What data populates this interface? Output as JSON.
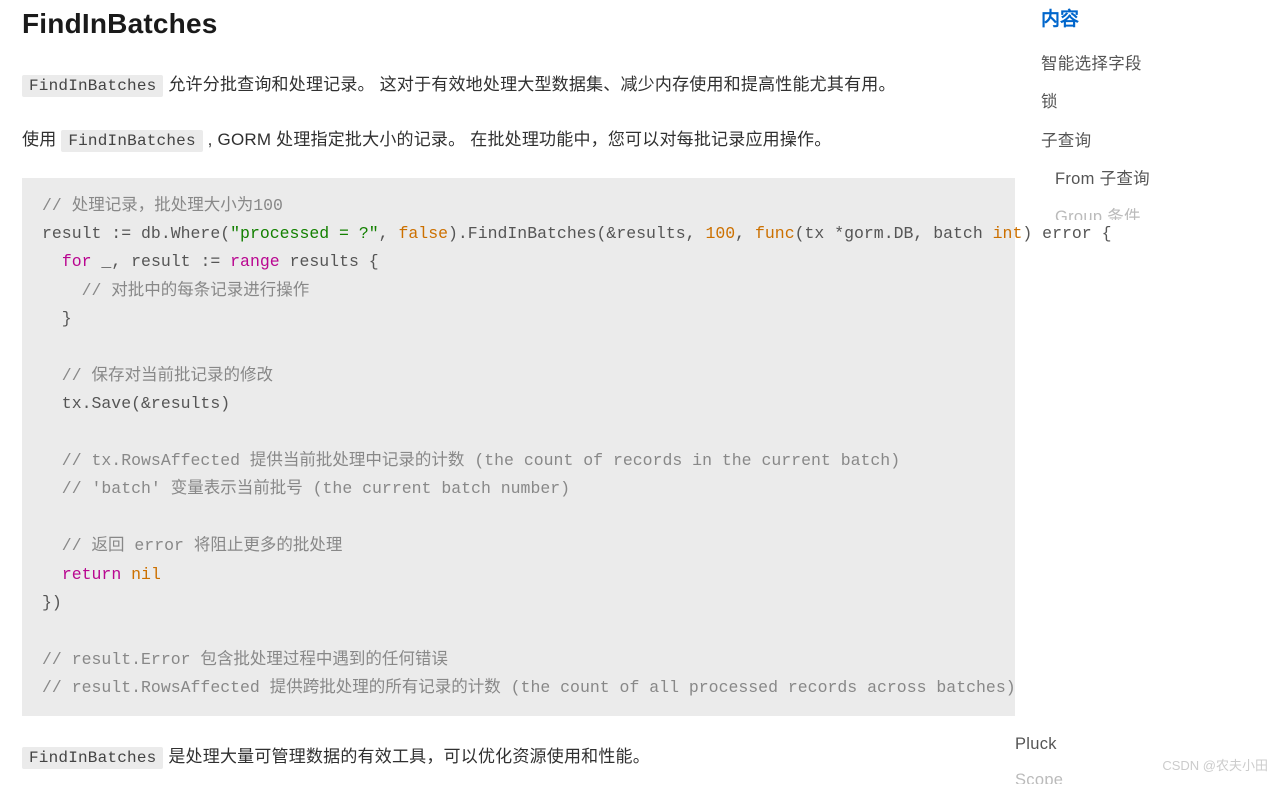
{
  "heading": "FindInBatches",
  "para1": {
    "pre": "",
    "code": "FindInBatches",
    "post": " 允许分批查询和处理记录。 这对于有效地处理大型数据集、减少内存使用和提高性能尤其有用。"
  },
  "para2": {
    "pre": "使用 ",
    "code": "FindInBatches",
    "post": " , GORM 处理指定批大小的记录。 在批处理功能中，您可以对每批记录应用操作。"
  },
  "code": {
    "c1": "// 处理记录，批处理大小为100",
    "l2_a": "result := db.Where(",
    "l2_str": "\"processed = ?\"",
    "l2_b": ", ",
    "l2_false": "false",
    "l2_c": ").FindInBatches(&results, ",
    "l2_num": "100",
    "l2_d": ", ",
    "l2_func": "func",
    "l2_e": "(tx *gorm.DB, batch ",
    "l2_int": "int",
    "l2_f": ") error {",
    "l3_a": "  ",
    "l3_for": "for",
    "l3_b": " _, result := ",
    "l3_range": "range",
    "l3_c": " results {",
    "c4": "    // 对批中的每条记录进行操作",
    "l5": "  }",
    "c7": "  // 保存对当前批记录的修改",
    "l8": "  tx.Save(&results)",
    "c10": "  // tx.RowsAffected 提供当前批处理中记录的计数 (the count of records in the current batch)",
    "c11": "  // 'batch' 变量表示当前批号 (the current batch number)",
    "c13": "  // 返回 error 将阻止更多的批处理",
    "l14_a": "  ",
    "l14_ret": "return",
    "l14_b": " ",
    "l14_nil": "nil",
    "l15": "})",
    "c17": "// result.Error 包含批处理过程中遇到的任何错误",
    "c18": "// result.RowsAffected 提供跨批处理的所有记录的计数 (the count of all processed records across batches)"
  },
  "para3": {
    "pre": "",
    "code": "FindInBatches",
    "post": " 是处理大量可管理数据的有效工具，可以优化资源使用和性能。"
  },
  "sidebar": {
    "title": "内容",
    "items": [
      "智能选择字段",
      "锁",
      "子查询",
      "From 子查询"
    ],
    "faded": "Group 条件",
    "float": [
      "Pluck",
      "Scope"
    ]
  },
  "watermark": "CSDN @农夫小田"
}
